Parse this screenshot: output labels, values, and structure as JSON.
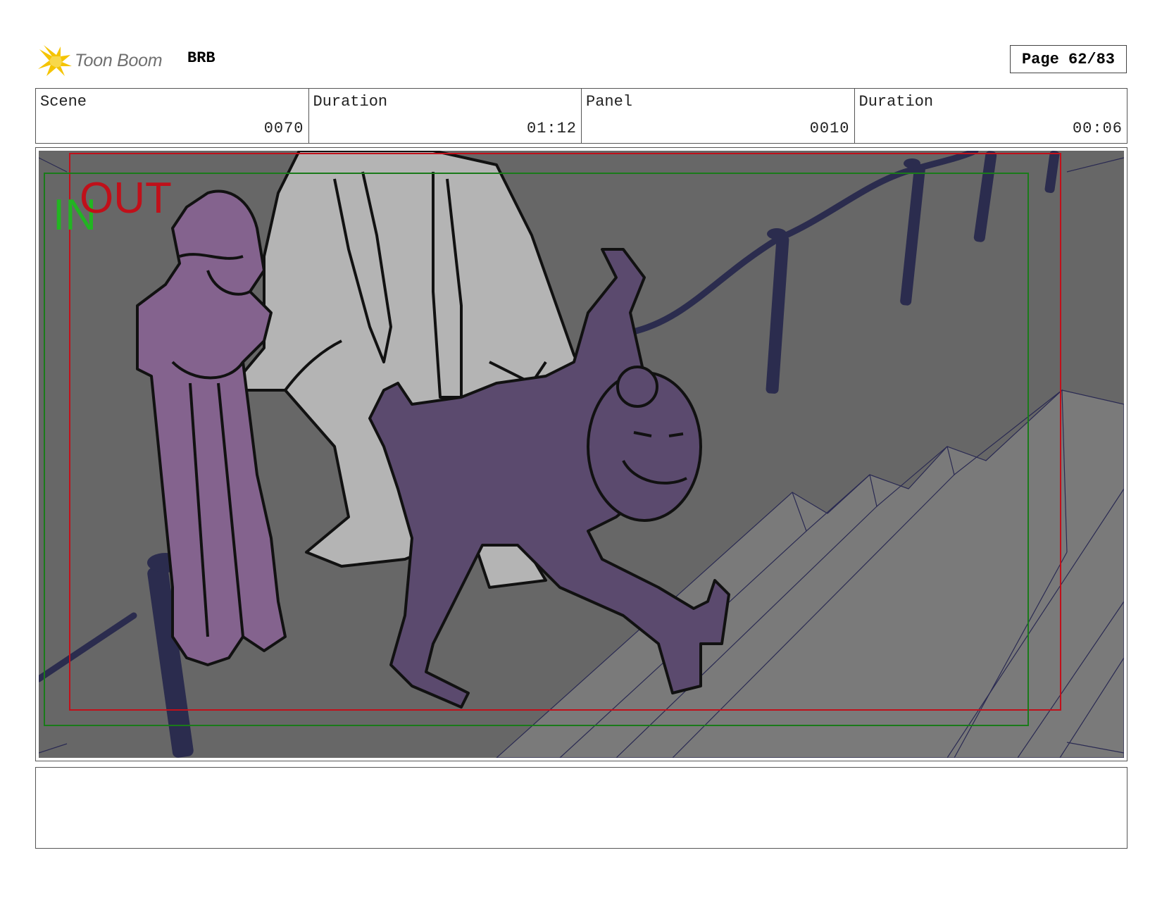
{
  "header": {
    "logo_text": "Toon Boom",
    "project": "BRB",
    "page": "Page 62/83"
  },
  "info": [
    {
      "label": "Scene",
      "value": "0070"
    },
    {
      "label": "Duration",
      "value": "01:12"
    },
    {
      "label": "Panel",
      "value": "0010"
    },
    {
      "label": "Duration",
      "value": "00:06"
    }
  ],
  "panel": {
    "in_label": "IN",
    "out_label": "OUT",
    "colors": {
      "background": "#676767",
      "in_frame": "#1a7a1a",
      "out_frame": "#c0101a",
      "stanchion": "#2b2c4e",
      "fallen_girl": "#5b4a6e",
      "standing_girl": "#84638e",
      "man": "#b4b4b4"
    }
  },
  "notes": {
    "text": ""
  }
}
